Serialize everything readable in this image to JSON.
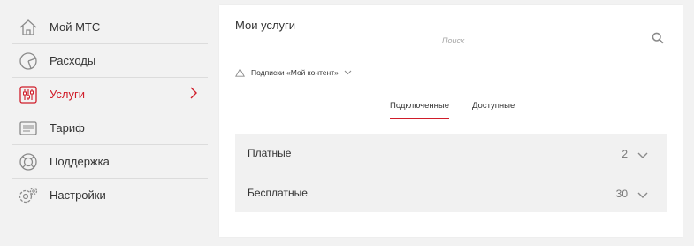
{
  "sidebar": {
    "items": [
      {
        "label": "Мой МТС",
        "icon": "home-icon"
      },
      {
        "label": "Расходы",
        "icon": "pie-chart-icon"
      },
      {
        "label": "Услуги",
        "icon": "sliders-icon",
        "active": true
      },
      {
        "label": "Тариф",
        "icon": "tariff-card-icon"
      },
      {
        "label": "Поддержка",
        "icon": "lifebuoy-icon"
      },
      {
        "label": "Настройки",
        "icon": "gear-icon"
      }
    ]
  },
  "main": {
    "title": "Мои услуги",
    "search": {
      "placeholder": "Поиск",
      "value": "",
      "icon": "search-icon"
    },
    "notice": {
      "label": "Подписки «Мой контент»",
      "icon": "warning-icon"
    },
    "tabs": [
      {
        "label": "Подключенные",
        "active": true
      },
      {
        "label": "Доступные",
        "active": false
      }
    ],
    "sections": [
      {
        "label": "Платные",
        "count": "2"
      },
      {
        "label": "Бесплатные",
        "count": "30"
      }
    ]
  },
  "colors": {
    "accent": "#d01d2a",
    "icon": "#8a8a8a",
    "background": "#f2f2f2"
  }
}
